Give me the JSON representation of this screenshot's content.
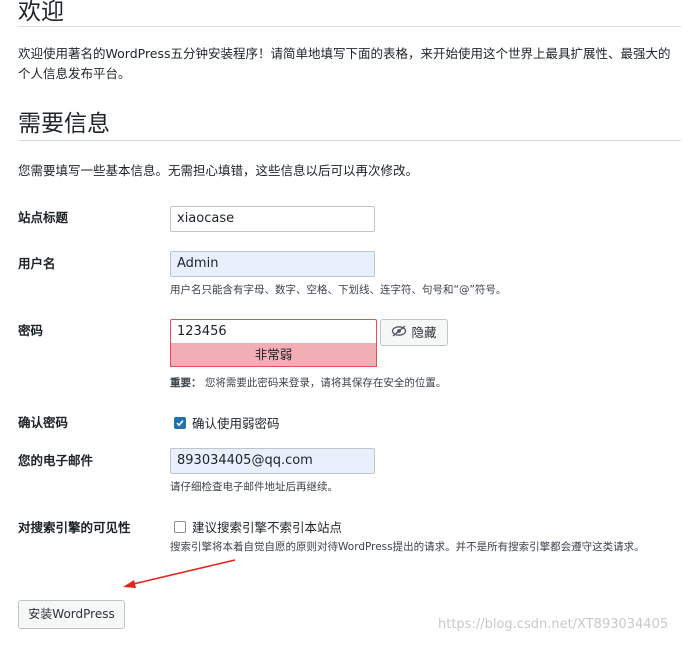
{
  "welcome": {
    "title": "欢迎",
    "intro": "欢迎使用著名的WordPress五分钟安装程序！请简单地填写下面的表格，来开始使用这个世界上最具扩展性、最强大的个人信息发布平台。"
  },
  "info": {
    "title": "需要信息",
    "subtitle": "您需要填写一些基本信息。无需担心填错，这些信息以后可以再次修改。"
  },
  "form": {
    "site_title": {
      "label": "站点标题",
      "value": "xiaocase"
    },
    "username": {
      "label": "用户名",
      "value": "Admin",
      "hint": "用户名只能含有字母、数字、空格、下划线、连字符、句号和“@”符号。"
    },
    "password": {
      "label": "密码",
      "value": "123456",
      "hide_label": "隐藏",
      "strength": "非常弱",
      "hint_strong": "重要：",
      "hint": "您将需要此密码来登录，请将其保存在安全的位置。"
    },
    "confirm": {
      "label": "确认密码",
      "checkbox_label": "确认使用弱密码",
      "checked": true
    },
    "email": {
      "label": "您的电子邮件",
      "value": "893034405@qq.com",
      "hint": "请仔细检查电子邮件地址后再继续。"
    },
    "search": {
      "label": "对搜索引擎的可见性",
      "checkbox_label": "建议搜索引擎不索引本站点",
      "checked": false,
      "hint": "搜索引擎将本着自觉自愿的原则对待WordPress提出的请求。并不是所有搜索引擎都会遵守这类请求。"
    }
  },
  "submit": {
    "label": "安装WordPress"
  },
  "watermark": "https://blog.csdn.net/XT893034405",
  "colors": {
    "accent": "#2271b1",
    "weak": "#f1aeb5",
    "arrow": "#e2231a"
  },
  "icons": {
    "hide": "eye-slash-icon",
    "check": "checkmark-icon",
    "arrow": "annotation-arrow-icon"
  }
}
